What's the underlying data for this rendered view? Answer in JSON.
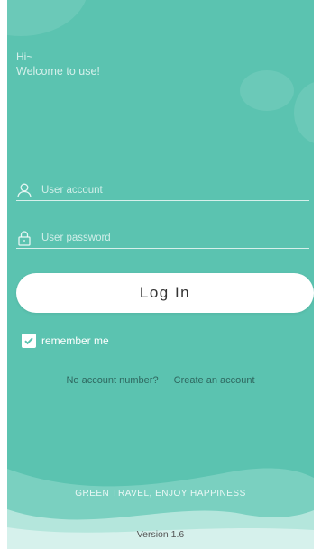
{
  "greeting": {
    "hi": "Hi~",
    "welcome": "Welcome to use!"
  },
  "form": {
    "account_placeholder": "User account",
    "password_placeholder": "User password",
    "login_label": "Log In",
    "remember_label": "remember me",
    "remember_checked": true
  },
  "links": {
    "no_account": "No account number?",
    "create": "Create an account"
  },
  "footer": {
    "slogan": "GREEN TRAVEL, ENJOY HAPPINESS",
    "version": "Version 1.6"
  },
  "icons": {
    "account": "user-icon",
    "password": "lock-icon",
    "checkbox": "check-icon"
  },
  "colors": {
    "background": "#5bc3b0",
    "button": "#ffffff",
    "link": "#2f6860"
  }
}
